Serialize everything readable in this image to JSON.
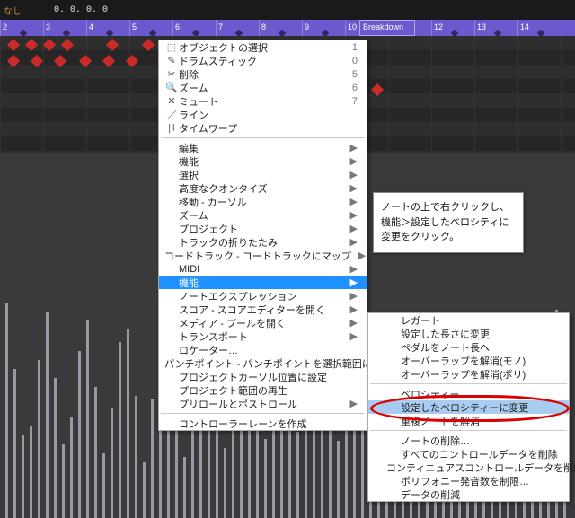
{
  "toolbar": {
    "left_label": "なし",
    "vals": "0. 0. 0. 0"
  },
  "ruler": {
    "start": 2,
    "count": 13,
    "marker": "Breakdown"
  },
  "menu1_top": [
    {
      "icon": "⬚",
      "label": "オブジェクトの選択",
      "kb": "1"
    },
    {
      "icon": "✎",
      "label": "ドラムスティック",
      "kb": "0"
    },
    {
      "icon": "✂",
      "label": "削除",
      "kb": "5"
    },
    {
      "icon": "🔍",
      "label": "ズーム",
      "kb": "6"
    },
    {
      "icon": "✕",
      "label": "ミュート",
      "kb": "7"
    },
    {
      "icon": "／",
      "label": "ライン",
      "kb": ""
    },
    {
      "icon": "|‖",
      "label": "タイムワープ",
      "kb": ""
    }
  ],
  "menu1_mid": [
    "編集",
    "機能",
    "選択",
    "高度なクオンタイズ",
    "移動 - カーソル",
    "ズーム",
    "プロジェクト",
    "トラックの折りたたみ",
    "コードトラック - コードトラックにマップ",
    "MIDI"
  ],
  "menu1_selected": "機能",
  "menu1_mid2": [
    "ノートエクスプレッション",
    "スコア - スコアエディターを開く",
    "メディア - プールを開く",
    "トランスポート",
    "ロケーター…",
    "パンチポイント - パンチポイントを選択範囲に設定",
    "プロジェクトカーソル位置に設定",
    "プロジェクト範囲の再生",
    "プリロールとポストロール"
  ],
  "menu1_bottom": "コントローラーレーンを作成",
  "menu2": [
    "レガート",
    "設定した長さに変更",
    "ペダルをノート長へ",
    "オーバーラップを解消(モノ)",
    "オーバーラップを解消(ポリ)"
  ],
  "menu2_grey1": "ベロシティー…",
  "menu2_selected": "設定したベロシティーに変更",
  "menu2_grey2": "重複ノートを解消",
  "menu2_b": [
    "ノートの削除…",
    "すべてのコントロールデータを削除",
    "コンティニュアスコントロールデータを削除",
    "ポリフォニー発音数を制限…",
    "データの削減"
  ],
  "note": {
    "l1": "ノートの上で右クリックし、",
    "l2": "機能＞設定したベロシティに",
    "l3": "変更をクリック。"
  }
}
